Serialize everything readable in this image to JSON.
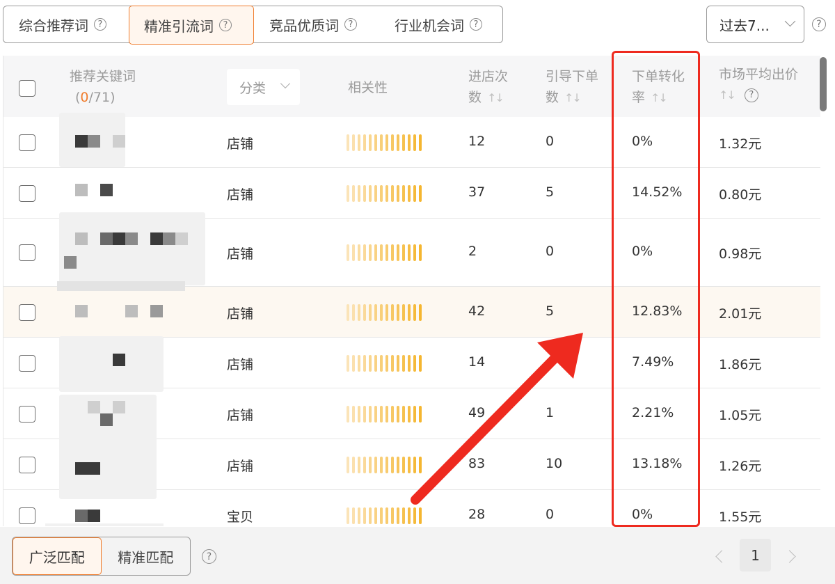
{
  "tabs": [
    {
      "label": "综合推荐词"
    },
    {
      "label": "精准引流词"
    },
    {
      "label": "竞品优质词"
    },
    {
      "label": "行业机会词"
    }
  ],
  "active_tab": "精准引流词",
  "period": {
    "value": "过去7..."
  },
  "help_glyph": "?",
  "table": {
    "headers": {
      "keyword": "推荐关键词",
      "keyword_count_selected": "0",
      "keyword_count_total": "/71",
      "category": "分类",
      "relevance": "相关性",
      "visits": [
        "进店次",
        "数"
      ],
      "orders": [
        "引导下单",
        "数"
      ],
      "conversion": [
        "下单转化",
        "率"
      ],
      "avg_bid": "市场平均出价",
      "sort_icon": "↑↓"
    },
    "rows": [
      {
        "category": "店铺",
        "relevance": 1.0,
        "visits": "12",
        "orders": "0",
        "conversion": "0%",
        "avg_bid": "1.32元"
      },
      {
        "category": "店铺",
        "relevance": 1.0,
        "visits": "37",
        "orders": "5",
        "conversion": "14.52%",
        "avg_bid": "0.80元"
      },
      {
        "category": "店铺",
        "relevance": 1.0,
        "visits": "2",
        "orders": "0",
        "conversion": "0%",
        "avg_bid": "0.98元"
      },
      {
        "category": "店铺",
        "relevance": 1.0,
        "visits": "42",
        "orders": "5",
        "conversion": "12.83%",
        "avg_bid": "2.01元"
      },
      {
        "category": "店铺",
        "relevance": 1.0,
        "visits": "14",
        "orders": "",
        "conversion": "7.49%",
        "avg_bid": "1.86元"
      },
      {
        "category": "店铺",
        "relevance": 1.0,
        "visits": "49",
        "orders": "1",
        "conversion": "2.21%",
        "avg_bid": "1.05元"
      },
      {
        "category": "店铺",
        "relevance": 1.0,
        "visits": "83",
        "orders": "10",
        "conversion": "13.18%",
        "avg_bid": "1.26元"
      },
      {
        "category": "宝贝",
        "relevance": 1.0,
        "visits": "28",
        "orders": "0",
        "conversion": "0%",
        "avg_bid": "1.55元"
      }
    ]
  },
  "match": {
    "broad": "广泛匹配",
    "exact": "精准匹配"
  },
  "pagination": {
    "current": "1"
  },
  "colors": {
    "accent": "#f07c2c",
    "annotation_red": "#ee2a1f",
    "bar_fill": "#f5b630",
    "bar_empty": "#fbe2b0"
  }
}
